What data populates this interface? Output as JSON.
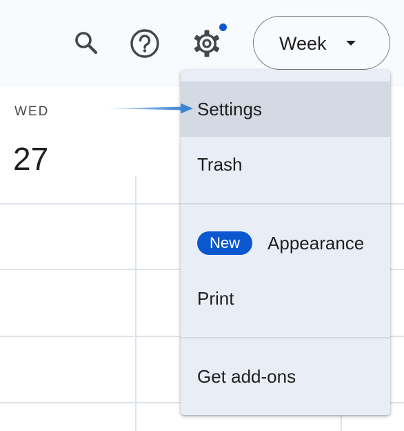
{
  "toolbar": {
    "search_icon": "search-icon",
    "help_icon": "help-icon",
    "settings_icon": "gear-icon",
    "notification_dot_color": "#0b57d0",
    "view_selector": {
      "label": "Week",
      "icon": "caret-down-icon"
    }
  },
  "calendar": {
    "day_name": "WED",
    "day_number": "27"
  },
  "menu": {
    "items": [
      {
        "label": "Settings",
        "highlighted": true
      },
      {
        "label": "Trash"
      },
      {
        "label": "Appearance",
        "badge": "New"
      },
      {
        "label": "Print"
      },
      {
        "label": "Get add-ons"
      }
    ]
  },
  "colors": {
    "accent": "#0b57d0",
    "annotation_arrow": "#3a86d4",
    "menu_bg": "#e9eef6",
    "header_bg": "#f8fafd"
  }
}
